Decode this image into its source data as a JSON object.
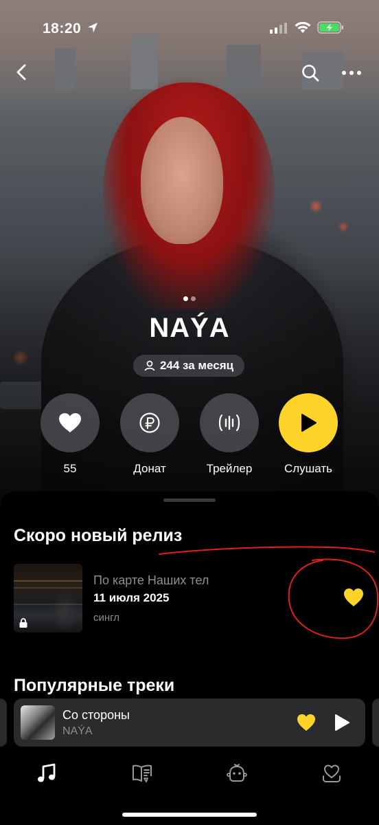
{
  "status_bar": {
    "time": "18:20"
  },
  "artist": {
    "name": "NAÝA",
    "monthly_listeners": "244 за месяц"
  },
  "carousel": {
    "pages": 2,
    "active": 0
  },
  "actions": [
    {
      "label": "55",
      "icon": "heart-icon"
    },
    {
      "label": "Донат",
      "icon": "ruble-icon"
    },
    {
      "label": "Трейлер",
      "icon": "trailer-icon"
    },
    {
      "label": "Слушать",
      "icon": "play-icon"
    }
  ],
  "upcoming": {
    "title": "Скоро новый релиз",
    "release": {
      "name": "По карте Наших тел",
      "date": "11 июля 2025",
      "type": "сингл"
    }
  },
  "popular": {
    "title": "Популярные треки"
  },
  "mini_player": {
    "track": "Со стороны",
    "artist": "NAÝA"
  },
  "tabs": [
    {
      "name": "music",
      "icon": "music-note-icon",
      "active": true
    },
    {
      "name": "books",
      "icon": "book-icon",
      "active": false
    },
    {
      "name": "kids",
      "icon": "kids-icon",
      "active": false
    },
    {
      "name": "collection",
      "icon": "heart-collection-icon",
      "active": false
    }
  ],
  "colors": {
    "accent": "#fed42b",
    "annotation": "#e0201e",
    "secondary_text": "#8e8e93"
  }
}
